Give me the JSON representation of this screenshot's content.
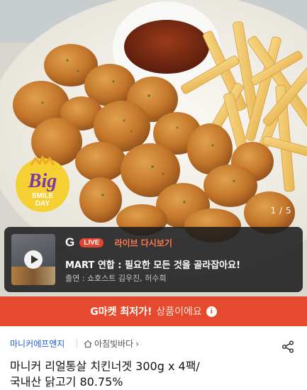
{
  "hero": {
    "slide_counter": "1 / 5",
    "badge": {
      "big": "Big",
      "line1": "SMILE",
      "line2": "DAY"
    }
  },
  "live": {
    "logo": "G",
    "badge": "LIVE",
    "replay_label": "라이브 다시보기",
    "title": "MART 연합 : 필요한 모든 것을 골라잡아요!",
    "cast": "출연 : 쇼호스트 김우진, 허수희"
  },
  "promo": {
    "strong": "G마켓 최저가!",
    "rest": "상품이에요",
    "info_icon": "i"
  },
  "seller": {
    "name": "마니커에프앤지",
    "brand": "아침빛바다",
    "brand_chevron": "›"
  },
  "product": {
    "title_line1": "마니커 리얼통살 치킨너겟 300g x 4팩/",
    "title_line2": "국내산 닭고기 80.75%"
  },
  "colors": {
    "promo_bg": "#e64a2e",
    "seller_link": "#2a5bd7",
    "live_badge": "#e7422e"
  }
}
